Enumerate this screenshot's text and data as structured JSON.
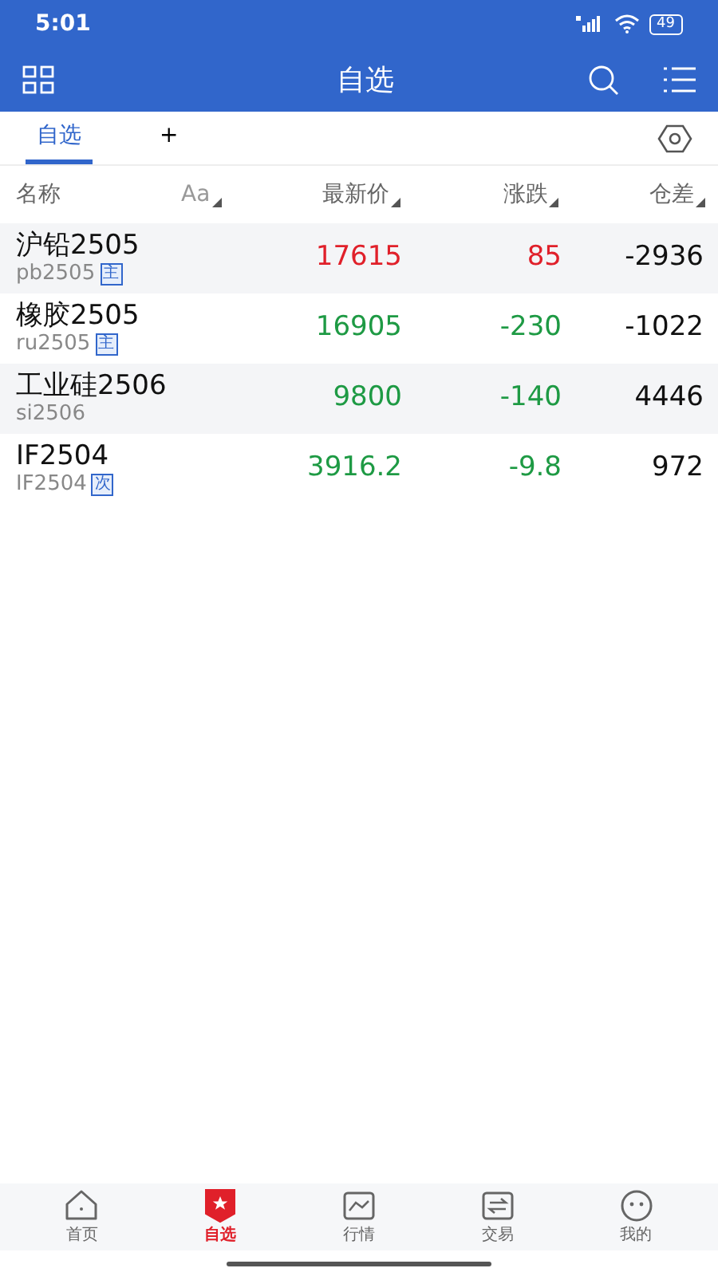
{
  "status_bar": {
    "time": "5:01",
    "battery": "49"
  },
  "header": {
    "title": "自选"
  },
  "tabs": [
    {
      "label": "自选",
      "selected": true
    },
    {
      "label": "+",
      "selected": false
    }
  ],
  "columns": [
    {
      "label": "名称"
    },
    {
      "label": "Aa"
    },
    {
      "label": "最新价"
    },
    {
      "label": "涨跌"
    },
    {
      "label": "仓差"
    }
  ],
  "rows": [
    {
      "name": "沪铅2505",
      "code": "pb2505",
      "badge": "主",
      "price": "17615",
      "change": "85",
      "kind": "up",
      "oi_change": "-2936"
    },
    {
      "name": "橡胶2505",
      "code": "ru2505",
      "badge": "主",
      "price": "16905",
      "change": "-230",
      "kind": "down",
      "oi_change": "-1022"
    },
    {
      "name": "工业硅2506",
      "code": "si2506",
      "price": "9800",
      "change": "-140",
      "kind": "down",
      "oi_change": "4446"
    },
    {
      "name": "IF2504",
      "code": "IF2504",
      "badge": "次",
      "price": "3916.2",
      "change": "-9.8",
      "kind": "down",
      "oi_change": "972"
    }
  ],
  "bottom_nav": [
    {
      "label": "首页",
      "kind": "home",
      "selected": false
    },
    {
      "label": "自选",
      "kind": "star",
      "selected": true
    },
    {
      "label": "行情",
      "kind": "chart",
      "selected": false
    },
    {
      "label": "交易",
      "kind": "swap",
      "selected": false
    },
    {
      "label": "我的",
      "kind": "face",
      "selected": false
    }
  ]
}
